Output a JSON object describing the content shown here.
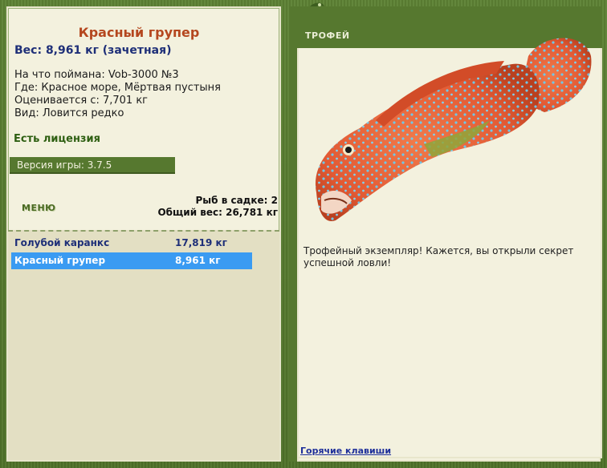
{
  "fish": {
    "name": "Красный групер",
    "weight_line": "Вес: 8,961 кг (зачетная)",
    "caught_with": "На что поймана: Vob-3000 №3",
    "where": "Где: Красное море, Мёртвая пустыня",
    "valued_from": "Оценивается с: 7,701 кг",
    "view": "Вид: Ловится редко"
  },
  "license": "Есть лицензия",
  "version": "Версия игры: 3.7.5",
  "menu_label": "МЕНЮ",
  "keepnet": {
    "count": "Рыб в садке: 2",
    "total_weight": "Общий вес: 26,781 кг"
  },
  "catches": [
    {
      "name": "Голубой каранкс",
      "weight": "17,819 кг"
    },
    {
      "name": "Красный групер",
      "weight": "8,961 кг"
    }
  ],
  "trophy": {
    "tab": "ТРОФЕЙ",
    "text": "Трофейный экземпляр! Кажется, вы открыли секрет успешной ловли!"
  },
  "hotkeys": "Горячие клавиши",
  "colors": {
    "frame": "#56782f",
    "panel": "#f3f1de",
    "title": "#b5471f",
    "selected": "#3a9bf2",
    "link": "#1e2f9a"
  }
}
